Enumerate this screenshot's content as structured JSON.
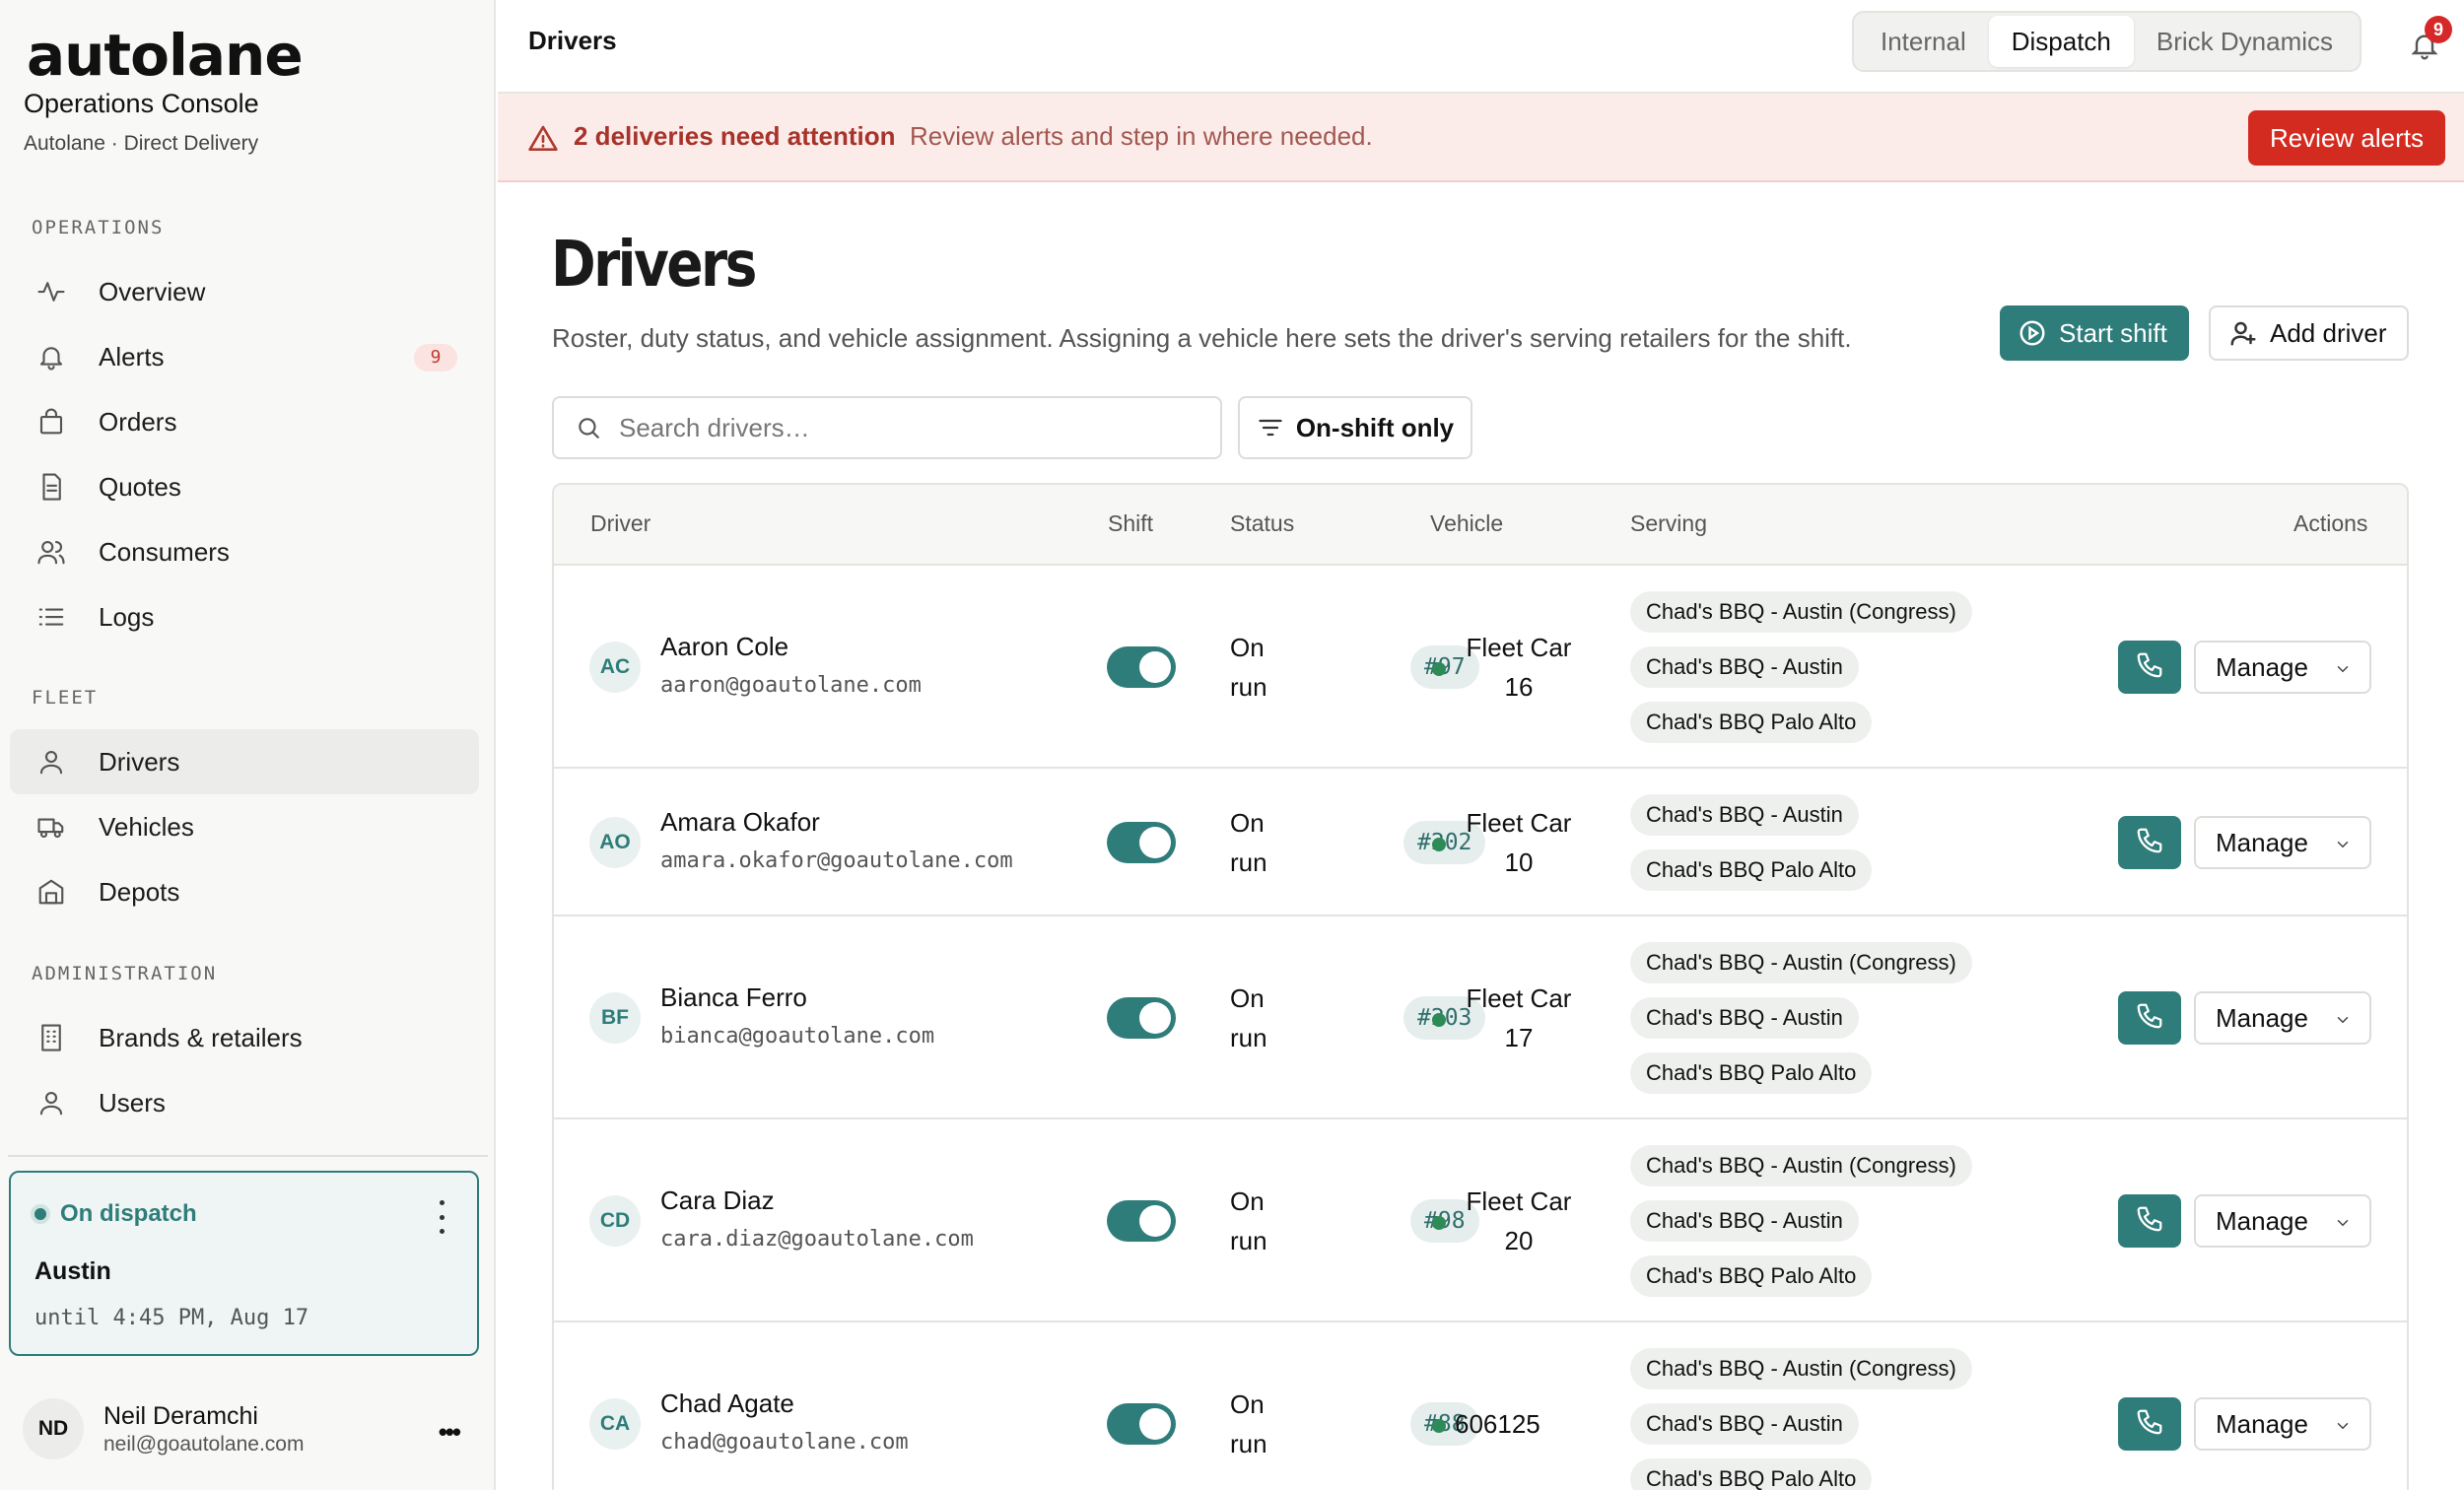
{
  "app": {
    "logo": "autolane",
    "title": "Operations Console",
    "subtitle": "Autolane · Direct Delivery"
  },
  "sidebar": {
    "operations_label": "OPERATIONS",
    "fleet_label": "FLEET",
    "admin_label": "ADMINISTRATION",
    "operations": [
      {
        "label": "Overview",
        "icon": "activity-icon"
      },
      {
        "label": "Alerts",
        "icon": "bell-icon",
        "badge": "9"
      },
      {
        "label": "Orders",
        "icon": "bag-icon"
      },
      {
        "label": "Quotes",
        "icon": "document-icon"
      },
      {
        "label": "Consumers",
        "icon": "users-icon"
      },
      {
        "label": "Logs",
        "icon": "list-icon"
      }
    ],
    "fleet": [
      {
        "label": "Drivers",
        "icon": "user-icon",
        "active": true
      },
      {
        "label": "Vehicles",
        "icon": "truck-icon"
      },
      {
        "label": "Depots",
        "icon": "warehouse-icon"
      }
    ],
    "admin": [
      {
        "label": "Brands & retailers",
        "icon": "building-icon"
      },
      {
        "label": "Users",
        "icon": "user-icon"
      }
    ],
    "dispatch": {
      "status": "On dispatch",
      "city": "Austin",
      "until": "until 4:45 PM, Aug 17"
    },
    "user": {
      "initials": "ND",
      "name": "Neil Deramchi",
      "email": "neil@goautolane.com",
      "more": "•••"
    }
  },
  "topbar": {
    "breadcrumb": "Drivers",
    "segments": [
      "Internal",
      "Dispatch",
      "Brick Dynamics"
    ],
    "active_segment": "Dispatch",
    "notifications": "9"
  },
  "alert": {
    "title": "2 deliveries need attention",
    "text": "Review alerts and step in where needed.",
    "button": "Review alerts"
  },
  "main": {
    "title": "Drivers",
    "description": "Roster, duty status, and vehicle assignment. Assigning a vehicle here sets the driver's serving retailers for the shift.",
    "start_shift": "Start shift",
    "add_driver": "Add driver",
    "search_placeholder": "Search drivers…",
    "filter": "On-shift only"
  },
  "table": {
    "columns": [
      "Driver",
      "Shift",
      "Status",
      "Vehicle",
      "Serving",
      "Actions"
    ],
    "manage_label": "Manage",
    "rows": [
      {
        "initials": "AC",
        "name": "Aaron Cole",
        "email": "aaron@goautolane.com",
        "shift_on": true,
        "status": "On run",
        "run": "#97",
        "vehicle": "Fleet Car 16",
        "serving": [
          "Chad's BBQ - Austin (Congress)",
          "Chad's BBQ - Austin",
          "Chad's BBQ Palo Alto"
        ]
      },
      {
        "initials": "AO",
        "name": "Amara Okafor",
        "email": "amara.okafor@goautolane.com",
        "shift_on": true,
        "status": "On run",
        "run": "#202",
        "vehicle": "Fleet Car 10",
        "serving": [
          "Chad's BBQ - Austin",
          "Chad's BBQ Palo Alto"
        ]
      },
      {
        "initials": "BF",
        "name": "Bianca Ferro",
        "email": "bianca@goautolane.com",
        "shift_on": true,
        "status": "On run",
        "run": "#203",
        "vehicle": "Fleet Car 17",
        "serving": [
          "Chad's BBQ - Austin (Congress)",
          "Chad's BBQ - Austin",
          "Chad's BBQ Palo Alto"
        ]
      },
      {
        "initials": "CD",
        "name": "Cara Diaz",
        "email": "cara.diaz@goautolane.com",
        "shift_on": true,
        "status": "On run",
        "run": "#98",
        "vehicle": "Fleet Car 20",
        "serving": [
          "Chad's BBQ - Austin (Congress)",
          "Chad's BBQ - Austin",
          "Chad's BBQ Palo Alto"
        ]
      },
      {
        "initials": "CA",
        "name": "Chad Agate",
        "email": "chad@goautolane.com",
        "shift_on": true,
        "status": "On run",
        "run": "#88",
        "vehicle": "606125",
        "serving": [
          "Chad's BBQ - Austin (Congress)",
          "Chad's BBQ - Austin",
          "Chad's BBQ Palo Alto"
        ]
      }
    ]
  },
  "colors": {
    "accent": "#2f7d7a",
    "danger": "#d42b21",
    "alert_bg": "#fbecea"
  }
}
